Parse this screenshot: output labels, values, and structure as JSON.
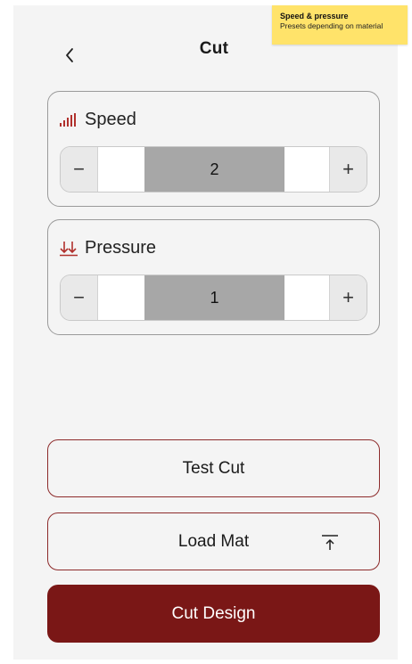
{
  "header": {
    "title": "Cut",
    "back_icon": "chevron-left-icon"
  },
  "sticky_note": {
    "title": "Speed & pressure",
    "body": "Presets depending on material",
    "color": "#ffe36a"
  },
  "speed": {
    "label": "Speed",
    "icon": "signal-bars-icon",
    "value": "2",
    "decrement_label": "−",
    "increment_label": "+"
  },
  "pressure": {
    "label": "Pressure",
    "icon": "double-down-arrow-icon",
    "value": "1",
    "decrement_label": "−",
    "increment_label": "+"
  },
  "actions": {
    "test_cut": "Test Cut",
    "load_mat": "Load Mat",
    "load_mat_icon": "upload-icon",
    "cut_design": "Cut Design"
  },
  "colors": {
    "accent": "#7a1716",
    "outline": "#8d2b2b",
    "icon_red": "#b0302c",
    "value_fill": "#a7a7a7",
    "screen_bg": "#f4f4f4"
  }
}
